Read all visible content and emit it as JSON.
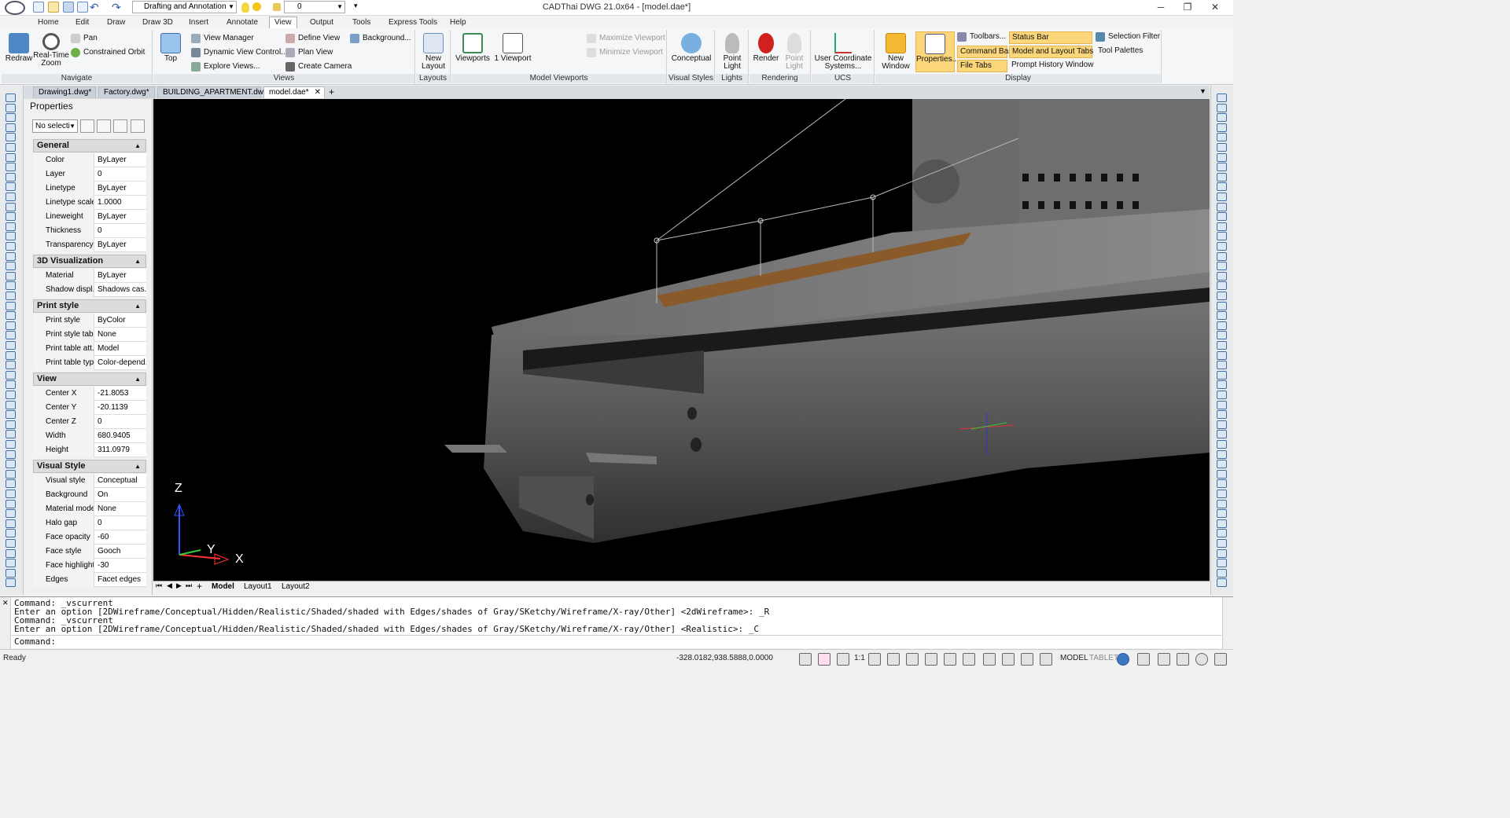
{
  "window": {
    "title": "CADThai DWG 21.0x64 - [model.dae*]"
  },
  "quick_access": {
    "workspace": "Drafting and Annotation",
    "layer": "0"
  },
  "menu": [
    {
      "label": "Home"
    },
    {
      "label": "Edit"
    },
    {
      "label": "Draw"
    },
    {
      "label": "Draw 3D"
    },
    {
      "label": "Insert"
    },
    {
      "label": "Annotate"
    },
    {
      "label": "View"
    },
    {
      "label": "Output"
    },
    {
      "label": "Tools"
    },
    {
      "label": "Express Tools"
    },
    {
      "label": "Help"
    }
  ],
  "ribbon": {
    "navigate": {
      "label": "Navigate",
      "redraw": "Redraw",
      "realtime_zoom": "Real-Time Zoom",
      "pan": "Pan",
      "constrained_orbit": "Constrained Orbit"
    },
    "views": {
      "label": "Views",
      "top": "Top",
      "view_manager": "View Manager",
      "dynamic_view": "Dynamic View Control...",
      "explore_views": "Explore Views...",
      "define_view": "Define View",
      "plan_view": "Plan View",
      "create_camera": "Create Camera",
      "background": "Background..."
    },
    "layouts": {
      "label": "Layouts",
      "new_layout": "New Layout"
    },
    "model_viewports": {
      "label": "Model Viewports",
      "viewports": "Viewports",
      "one_viewport": "1 Viewport",
      "maximize": "Maximize Viewport",
      "minimize": "Minimize Viewport"
    },
    "visual_styles": {
      "label": "Visual Styles",
      "conceptual": "Conceptual"
    },
    "lights": {
      "label": "Lights",
      "point_light": "Point Light"
    },
    "rendering": {
      "label": "Rendering",
      "render": "Render",
      "point_light": "Point Light"
    },
    "ucs": {
      "label": "UCS",
      "user_coordinate": "User Coordinate Systems..."
    },
    "display": {
      "label": "Display",
      "new_window": "New Window",
      "properties": "Properties...",
      "toolbars": "Toolbars...",
      "command_bar": "Command Bar",
      "file_tabs": "File Tabs",
      "status_bar": "Status Bar",
      "model_layout_tabs": "Model and Layout Tabs",
      "prompt_history": "Prompt History Window",
      "selection_filter": "Selection Filter",
      "tool_palettes": "Tool Palettes"
    }
  },
  "doc_tabs": [
    {
      "label": "Drawing1.dwg*"
    },
    {
      "label": "Factory.dwg*"
    },
    {
      "label": "BUILDING_APARTMENT.dwg*"
    },
    {
      "label": "model.dae*"
    }
  ],
  "properties": {
    "title": "Properties",
    "selection": "No selecti",
    "sections": [
      {
        "name": "General",
        "rows": [
          {
            "k": "Color",
            "v": "ByLayer"
          },
          {
            "k": "Layer",
            "v": "0"
          },
          {
            "k": "Linetype",
            "v": "ByLayer"
          },
          {
            "k": "Linetype scale",
            "v": "1.0000"
          },
          {
            "k": "Lineweight",
            "v": "ByLayer"
          },
          {
            "k": "Thickness",
            "v": "0"
          },
          {
            "k": "Transparency",
            "v": "ByLayer"
          }
        ]
      },
      {
        "name": "3D Visualization",
        "rows": [
          {
            "k": "Material",
            "v": "ByLayer"
          },
          {
            "k": "Shadow displ...",
            "v": "Shadows cas..."
          }
        ]
      },
      {
        "name": "Print style",
        "rows": [
          {
            "k": "Print style",
            "v": "ByColor"
          },
          {
            "k": "Print style table",
            "v": "None"
          },
          {
            "k": "Print table att...",
            "v": "Model"
          },
          {
            "k": "Print table type",
            "v": "Color-depend..."
          }
        ]
      },
      {
        "name": "View",
        "rows": [
          {
            "k": "Center X",
            "v": "-21.8053"
          },
          {
            "k": "Center Y",
            "v": "-20.1139"
          },
          {
            "k": "Center Z",
            "v": "0"
          },
          {
            "k": "Width",
            "v": "680.9405"
          },
          {
            "k": "Height",
            "v": "311.0979"
          }
        ]
      },
      {
        "name": "Visual Style",
        "rows": [
          {
            "k": "Visual style",
            "v": "Conceptual"
          },
          {
            "k": "Background",
            "v": "On"
          },
          {
            "k": "Material mode",
            "v": "None"
          },
          {
            "k": "Halo gap",
            "v": "0"
          },
          {
            "k": "Face opacity",
            "v": "-60"
          },
          {
            "k": "Face style",
            "v": "Gooch"
          },
          {
            "k": "Face highlight",
            "v": "-30"
          },
          {
            "k": "Edges",
            "v": "Facet edges"
          }
        ]
      }
    ]
  },
  "viewport": {
    "axis_x": "X",
    "axis_y": "Y",
    "axis_z": "Z"
  },
  "layout_tabs": [
    {
      "label": "Model"
    },
    {
      "label": "Layout1"
    },
    {
      "label": "Layout2"
    }
  ],
  "command": {
    "lines": [
      "Command: _vscurrent",
      "Enter an option [2DWireframe/Conceptual/Hidden/Realistic/Shaded/shaded with Edges/shades of Gray/SKetchy/Wireframe/X-ray/Other] <2dWireframe>: _R",
      "Command: _vscurrent",
      "Enter an option [2DWireframe/Conceptual/Hidden/Realistic/Shaded/shaded with Edges/shades of Gray/SKetchy/Wireframe/X-ray/Other] <Realistic>: _C"
    ],
    "prompt": "Command:"
  },
  "status": {
    "ready": "Ready",
    "coords": "-328.0182,938.5888,0.0000",
    "scale": "1:1",
    "model": "MODEL",
    "tablet": "TABLET"
  }
}
